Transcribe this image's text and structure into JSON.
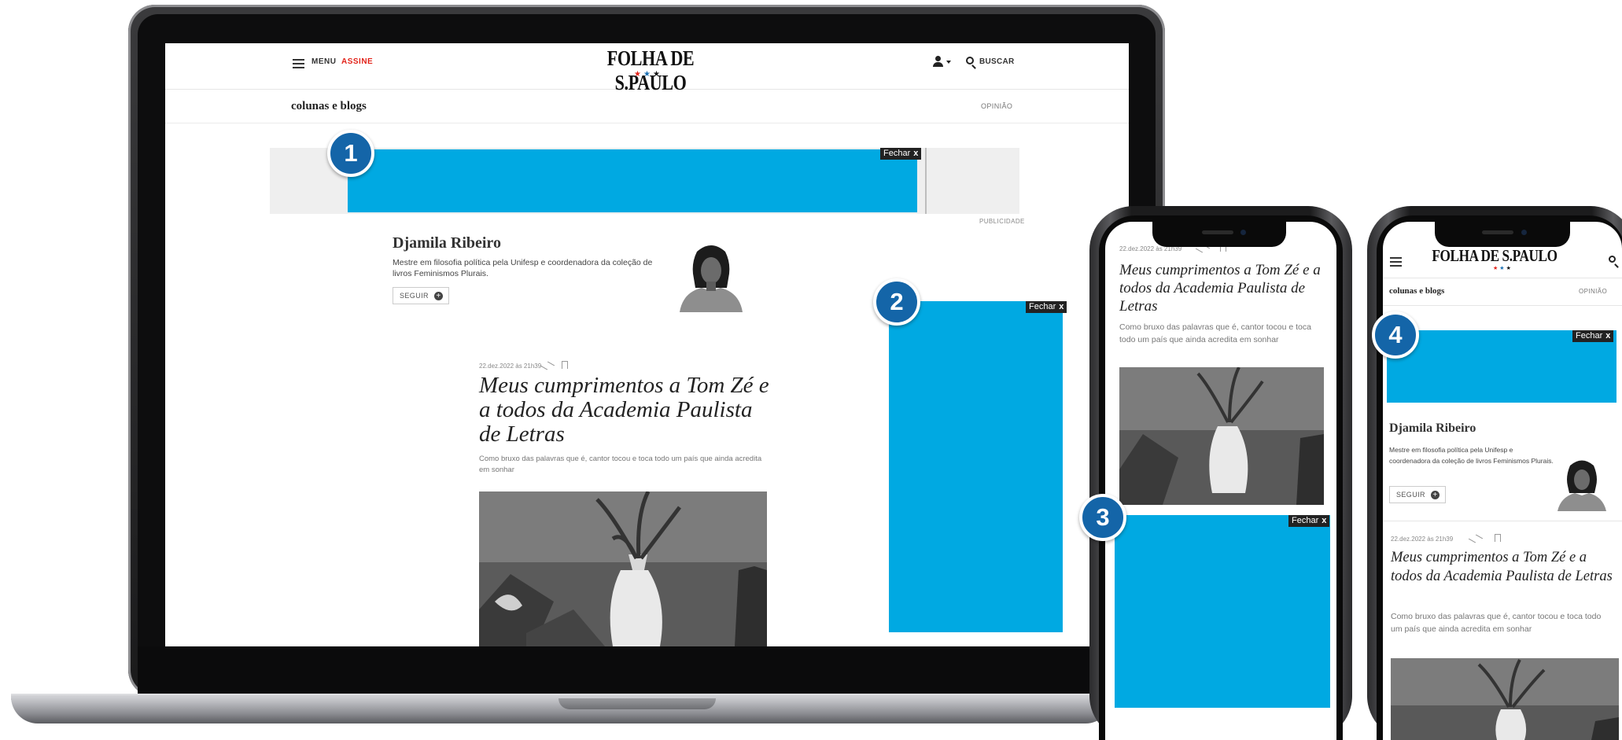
{
  "brand": {
    "logo_text": "FOLHA DE S.PAULO",
    "stars": "★★★",
    "accent_blue": "#1465a8",
    "ad_color": "#00a9e2",
    "red": "#e2231a"
  },
  "header": {
    "menu_label": "MENU",
    "subscribe_label": "ASSINE",
    "search_label": "BUSCAR"
  },
  "section": {
    "title": "colunas e blogs",
    "category": "OPINIÃO"
  },
  "ads": {
    "close_label": "Fechar",
    "close_x": "x",
    "publicidade": "PUBLICIDADE",
    "badges": [
      "1",
      "2",
      "3",
      "4"
    ]
  },
  "columnist": {
    "name": "Djamila Ribeiro",
    "bio": "Mestre em filosofia política pela Unifesp e coordenadora da coleção de livros Feminismos Plurais.",
    "follow_label": "SEGUIR",
    "follow_icon": "+"
  },
  "article": {
    "date": "22.dez.2022 às 21h39",
    "headline": "Meus cumprimentos a Tom Zé e a todos da Academia Paulista de Letras",
    "dek": "Como bruxo das palavras que é, cantor tocou e toca todo um país que ainda acredita em sonhar"
  }
}
